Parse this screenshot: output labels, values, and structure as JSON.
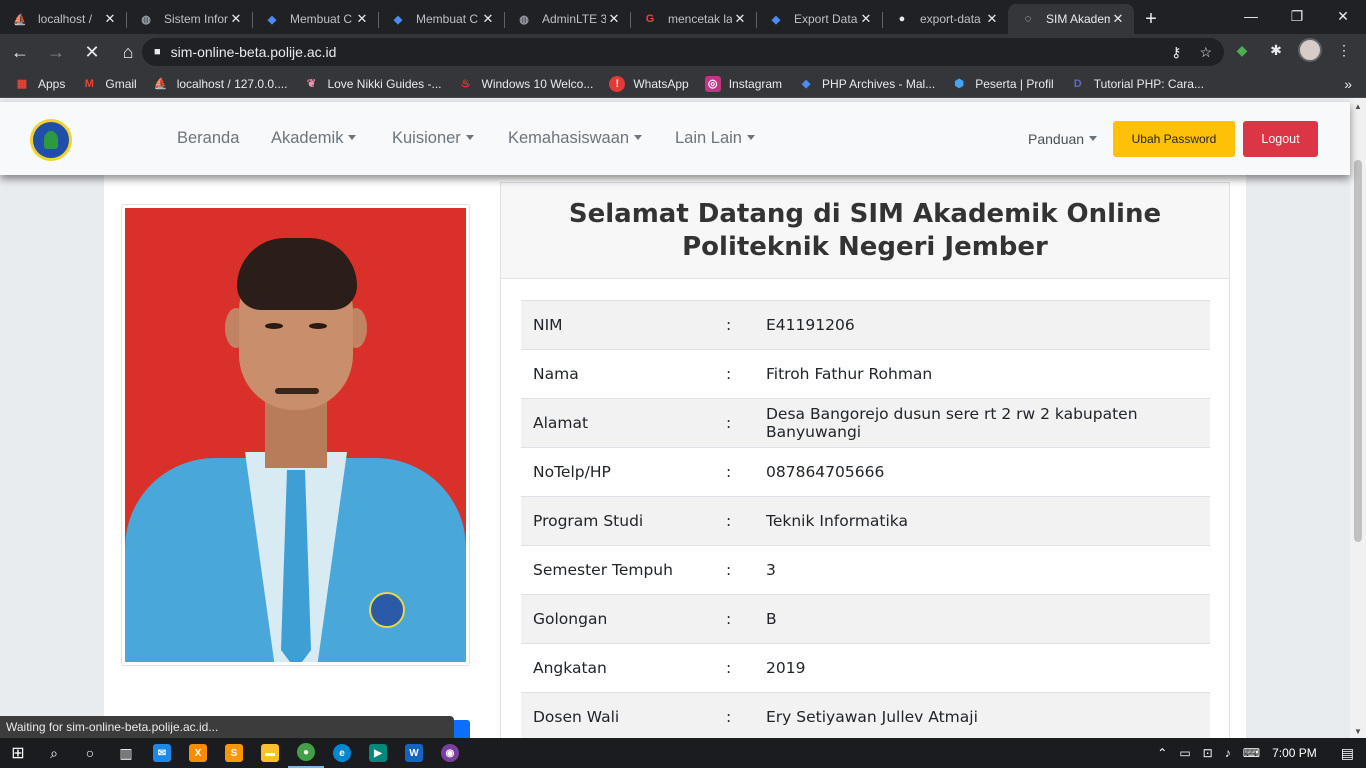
{
  "browser": {
    "tabs": [
      {
        "title": "localhost /",
        "icon": "phpmyadmin-icon"
      },
      {
        "title": "Sistem Infor",
        "icon": "globe-icon"
      },
      {
        "title": "Membuat C",
        "icon": "code-icon"
      },
      {
        "title": "Membuat C",
        "icon": "code-icon"
      },
      {
        "title": "AdminLTE 3",
        "icon": "globe-icon"
      },
      {
        "title": "mencetak la",
        "icon": "google-icon"
      },
      {
        "title": "Export Data",
        "icon": "code-icon"
      },
      {
        "title": "export-data",
        "icon": "github-icon"
      },
      {
        "title": "SIM Akadem",
        "icon": "loading-icon"
      }
    ],
    "url": "sim-online-beta.polije.ac.id",
    "bookmarks": [
      {
        "label": "Apps",
        "icon": "apps-grid-icon"
      },
      {
        "label": "Gmail",
        "icon": "gmail-icon"
      },
      {
        "label": "localhost / 127.0.0....",
        "icon": "phpmyadmin-icon"
      },
      {
        "label": "Love Nikki Guides -...",
        "icon": "bookmark-icon"
      },
      {
        "label": "Windows 10 Welco...",
        "icon": "bookmark-icon"
      },
      {
        "label": "WhatsApp",
        "icon": "whatsapp-icon"
      },
      {
        "label": "Instagram",
        "icon": "instagram-icon"
      },
      {
        "label": "PHP Archives - Mal...",
        "icon": "code-icon"
      },
      {
        "label": "Peserta | Profil",
        "icon": "bookmark-icon"
      },
      {
        "label": "Tutorial PHP: Cara...",
        "icon": "bookmark-icon"
      }
    ],
    "status": "Waiting for sim-online-beta.polije.ac.id..."
  },
  "navbar": {
    "menu": [
      {
        "label": "Beranda",
        "dropdown": false
      },
      {
        "label": "Akademik",
        "dropdown": true
      },
      {
        "label": "Kuisioner",
        "dropdown": true
      },
      {
        "label": "Kemahasiswaan",
        "dropdown": true
      },
      {
        "label": "Lain Lain",
        "dropdown": true
      }
    ],
    "panduan": "Panduan",
    "ubah_password": "Ubah Password",
    "logout": "Logout"
  },
  "welcome": {
    "line1": "Selamat Datang di SIM Akademik Online",
    "line2": "Politeknik Negeri Jember"
  },
  "student": {
    "separator": ":",
    "fields": [
      {
        "label": "NIM",
        "value": "E41191206"
      },
      {
        "label": "Nama",
        "value": "Fitroh Fathur Rohman"
      },
      {
        "label": "Alamat",
        "value": "Desa Bangorejo dusun sere rt 2 rw 2 kabupaten Banyuwangi"
      },
      {
        "label": "NoTelp/HP",
        "value": "087864705666"
      },
      {
        "label": "Program Studi",
        "value": "Teknik Informatika"
      },
      {
        "label": "Semester Tempuh",
        "value": "3"
      },
      {
        "label": "Golongan",
        "value": "B"
      },
      {
        "label": "Angkatan",
        "value": "2019"
      },
      {
        "label": "Dosen Wali",
        "value": "Ery Setiyawan Jullev Atmaji"
      }
    ]
  },
  "taskbar": {
    "time": "7:00 PM"
  },
  "colors": {
    "warning": "#ffc107",
    "danger": "#dc3545",
    "photo_background": "#d9302a"
  }
}
